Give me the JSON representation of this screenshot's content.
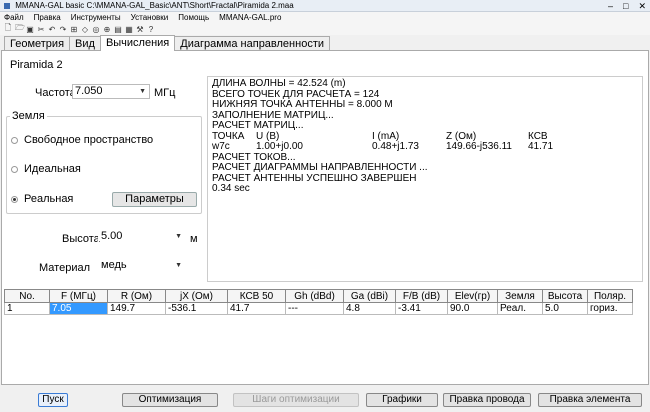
{
  "window": {
    "title": "MMANA-GAL basic C:\\MMANA-GAL_Basic\\ANT\\Short\\Fractal\\Piramida 2.maa",
    "controls": [
      "–",
      "□",
      "✕"
    ]
  },
  "menu": [
    "Файл",
    "Правка",
    "Инструменты",
    "Установки",
    "Помощь",
    "MMANA-GAL.pro"
  ],
  "toolbar_icons": [
    "new-file-icon",
    "open-file-icon",
    "save-icon",
    "cut-icon",
    "undo-icon",
    "redo-icon",
    "calc-icon",
    "geometry-icon",
    "view-icon",
    "zoom-icon",
    "build-icon",
    "table-icon",
    "tools-icon",
    "help-icon"
  ],
  "tabs": [
    "Геометрия",
    "Вид",
    "Вычисления",
    "Диаграмма направленности"
  ],
  "active_tab": "Вычисления",
  "antenna_name": "Piramida 2",
  "frequency": {
    "label": "Частота",
    "value": "7.050",
    "unit": "МГц"
  },
  "ground": {
    "title": "Земля",
    "options": [
      "Свободное пространство",
      "Идеальная",
      "Реальная"
    ],
    "selected": "Реальная",
    "params_button": "Параметры"
  },
  "height": {
    "label": "Высота",
    "value": "5.00",
    "unit": "м"
  },
  "material": {
    "label": "Материал",
    "value": "медь"
  },
  "output": {
    "line1": "ДЛИНА ВОЛНЫ = 42.524 (m)",
    "line2": "ВСЕГО ТОЧЕК ДЛЯ РАСЧЕТА = 124",
    "line3": "НИЖНЯЯ ТОЧКА АНТЕННЫ = 8.000 М",
    "line4": "ЗАПОЛНЕНИЕ МАТРИЦ...",
    "line5": "РАСЧЕТ МАТРИЦ...",
    "table_header": [
      "ТОЧКА",
      "U (В)",
      "I (mA)",
      "Z (Ом)",
      "КСВ"
    ],
    "table_row": [
      "w7c",
      "1.00+j0.00",
      "0.48+j1.73",
      "149.66-j536.11",
      "41.71"
    ],
    "line6": "РАСЧЕТ ТОКОВ...",
    "line7": "РАСЧЕТ ДИАГРАММЫ НАПРАВЛЕННОСТИ ...",
    "line8": "РАСЧЕТ АНТЕННЫ УСПЕШНО ЗАВЕРШЕН",
    "line9": "0.34 sec"
  },
  "results": {
    "headers": [
      "No.",
      "F (МГц)",
      "R (Ом)",
      "jX (Ом)",
      "КСВ 50",
      "Gh (dBd)",
      "Ga (dBi)",
      "F/B (dB)",
      "Elev(гр)",
      "Земля",
      "Высота",
      "Поляр."
    ],
    "rows": [
      [
        "1",
        "7.05",
        "149.7",
        "-536.1",
        "41.7",
        "---",
        "4.8",
        "-3.41",
        "90.0",
        "Реал.",
        "5.0",
        "гориз."
      ]
    ]
  },
  "buttons": {
    "start": "Пуск",
    "optimize": "Оптимизация",
    "opt_steps": "Шаги оптимизации",
    "graphs": "Графики",
    "edit_wire": "Правка провода",
    "edit_element": "Правка элемента"
  }
}
